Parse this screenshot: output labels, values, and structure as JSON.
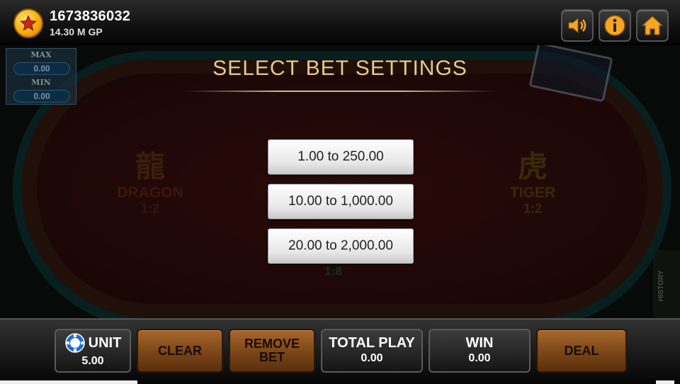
{
  "account": {
    "id": "1673836032",
    "balance": "14.30 M GP"
  },
  "toolbar": {
    "icons": [
      "sound-icon",
      "info-icon",
      "home-icon"
    ]
  },
  "limits": {
    "max_label": "MAX",
    "max_value": "0.00",
    "min_label": "MIN",
    "min_value": "0.00"
  },
  "table": {
    "dragon_glyph": "龍",
    "dragon_name": "DRAGON",
    "dragon_odds": "1:2",
    "tiger_glyph": "虎",
    "tiger_name": "TIGER",
    "tiger_odds": "1:2",
    "tie_odds": "1:8",
    "history_label": "HISTORY"
  },
  "modal": {
    "title": "SELECT BET SETTINGS",
    "options": [
      {
        "label": "1.00 to 250.00"
      },
      {
        "label": "10.00 to 1,000.00"
      },
      {
        "label": "20.00 to 2,000.00"
      }
    ]
  },
  "bottom": {
    "unit_label": "UNIT",
    "unit_value": "5.00",
    "clear_label": "CLEAR",
    "remove_line1": "REMOVE",
    "remove_line2": "BET",
    "total_label": "TOTAL PLAY",
    "total_value": "0.00",
    "win_label": "WIN",
    "win_value": "0.00",
    "deal_label": "DEAL"
  },
  "colors": {
    "accent_gold": "#e8c98a",
    "button_brown": "#7a4517",
    "felt_red": "#3a0f0e"
  }
}
